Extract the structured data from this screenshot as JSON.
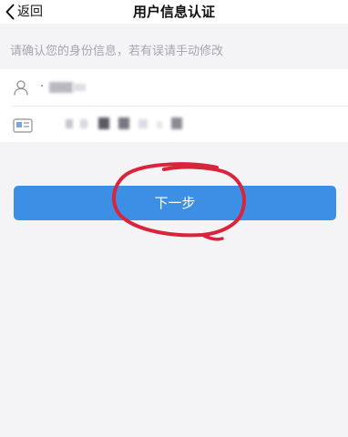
{
  "nav": {
    "back_label": "返回",
    "title": "用户信息认证"
  },
  "hint": "请确认您的身份信息，若有误请手动修改",
  "form": {
    "name_value": "·",
    "id_value": ""
  },
  "actions": {
    "next_label": "下一步"
  },
  "colors": {
    "background": "#f4f4f7",
    "primary_button": "#3d8fe5",
    "hint_text": "#a6a6ad",
    "annotation_circle": "#d9243c"
  },
  "icons": [
    "chevron-left-icon",
    "user-icon",
    "id-card-icon"
  ]
}
